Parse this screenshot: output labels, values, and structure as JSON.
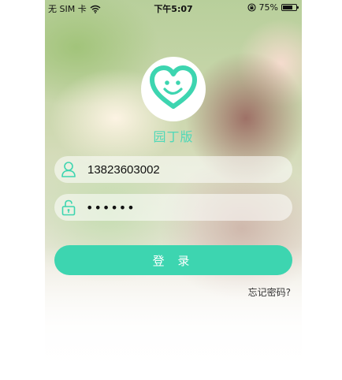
{
  "status_bar": {
    "carrier": "无 SIM 卡",
    "time": "下午5:07",
    "battery": "75%",
    "battery_level": 0.75
  },
  "logo": {
    "icon": "heart-smile-icon",
    "app_name": "园丁版",
    "brand_color": "#3dd5b0"
  },
  "login_form": {
    "username_icon": "user-icon",
    "username_value": "13823603002",
    "password_icon": "lock-icon",
    "password_masked": "••••••",
    "login_label": "登 录",
    "forgot_label": "忘记密码?"
  }
}
